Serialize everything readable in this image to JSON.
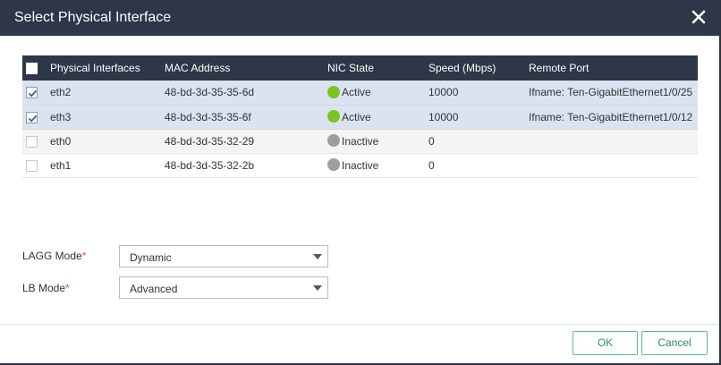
{
  "dialog": {
    "title": "Select Physical Interface"
  },
  "table": {
    "headers": {
      "iface": "Physical Interfaces",
      "mac": "MAC Address",
      "state": "NIC State",
      "speed": "Speed (Mbps)",
      "remote": "Remote Port"
    },
    "rows": [
      {
        "checked": true,
        "name": "eth2",
        "mac": "48-bd-3d-35-35-6d",
        "state": "Active",
        "state_color": "#7cc520",
        "speed": "10000",
        "remote": "Ifname: Ten-GigabitEthernet1/0/25"
      },
      {
        "checked": true,
        "name": "eth3",
        "mac": "48-bd-3d-35-35-6f",
        "state": "Active",
        "state_color": "#7cc520",
        "speed": "10000",
        "remote": "Ifname: Ten-GigabitEthernet1/0/12"
      },
      {
        "checked": false,
        "name": "eth0",
        "mac": "48-bd-3d-35-32-29",
        "state": "Inactive",
        "state_color": "#9e9e9e",
        "speed": "0",
        "remote": ""
      },
      {
        "checked": false,
        "name": "eth1",
        "mac": "48-bd-3d-35-32-2b",
        "state": "Inactive",
        "state_color": "#9e9e9e",
        "speed": "0",
        "remote": ""
      }
    ]
  },
  "form": {
    "lagg_label": "LAGG Mode",
    "lagg_value": "Dynamic",
    "lb_label": "LB Mode",
    "lb_value": "Advanced",
    "required_mark": "*"
  },
  "footer": {
    "ok_label": "OK",
    "cancel_label": "Cancel"
  },
  "colors": {
    "header_bg": "#2d3748",
    "selected_row_bg": "#dbe3f1",
    "active": "#7cc520",
    "inactive": "#9e9e9e",
    "button_accent": "#2a8c6d",
    "checkbox_check": "#2f5fa8"
  },
  "icons": {
    "close": "close-icon",
    "check": "checkmark-icon",
    "caret": "caret-down-icon"
  }
}
